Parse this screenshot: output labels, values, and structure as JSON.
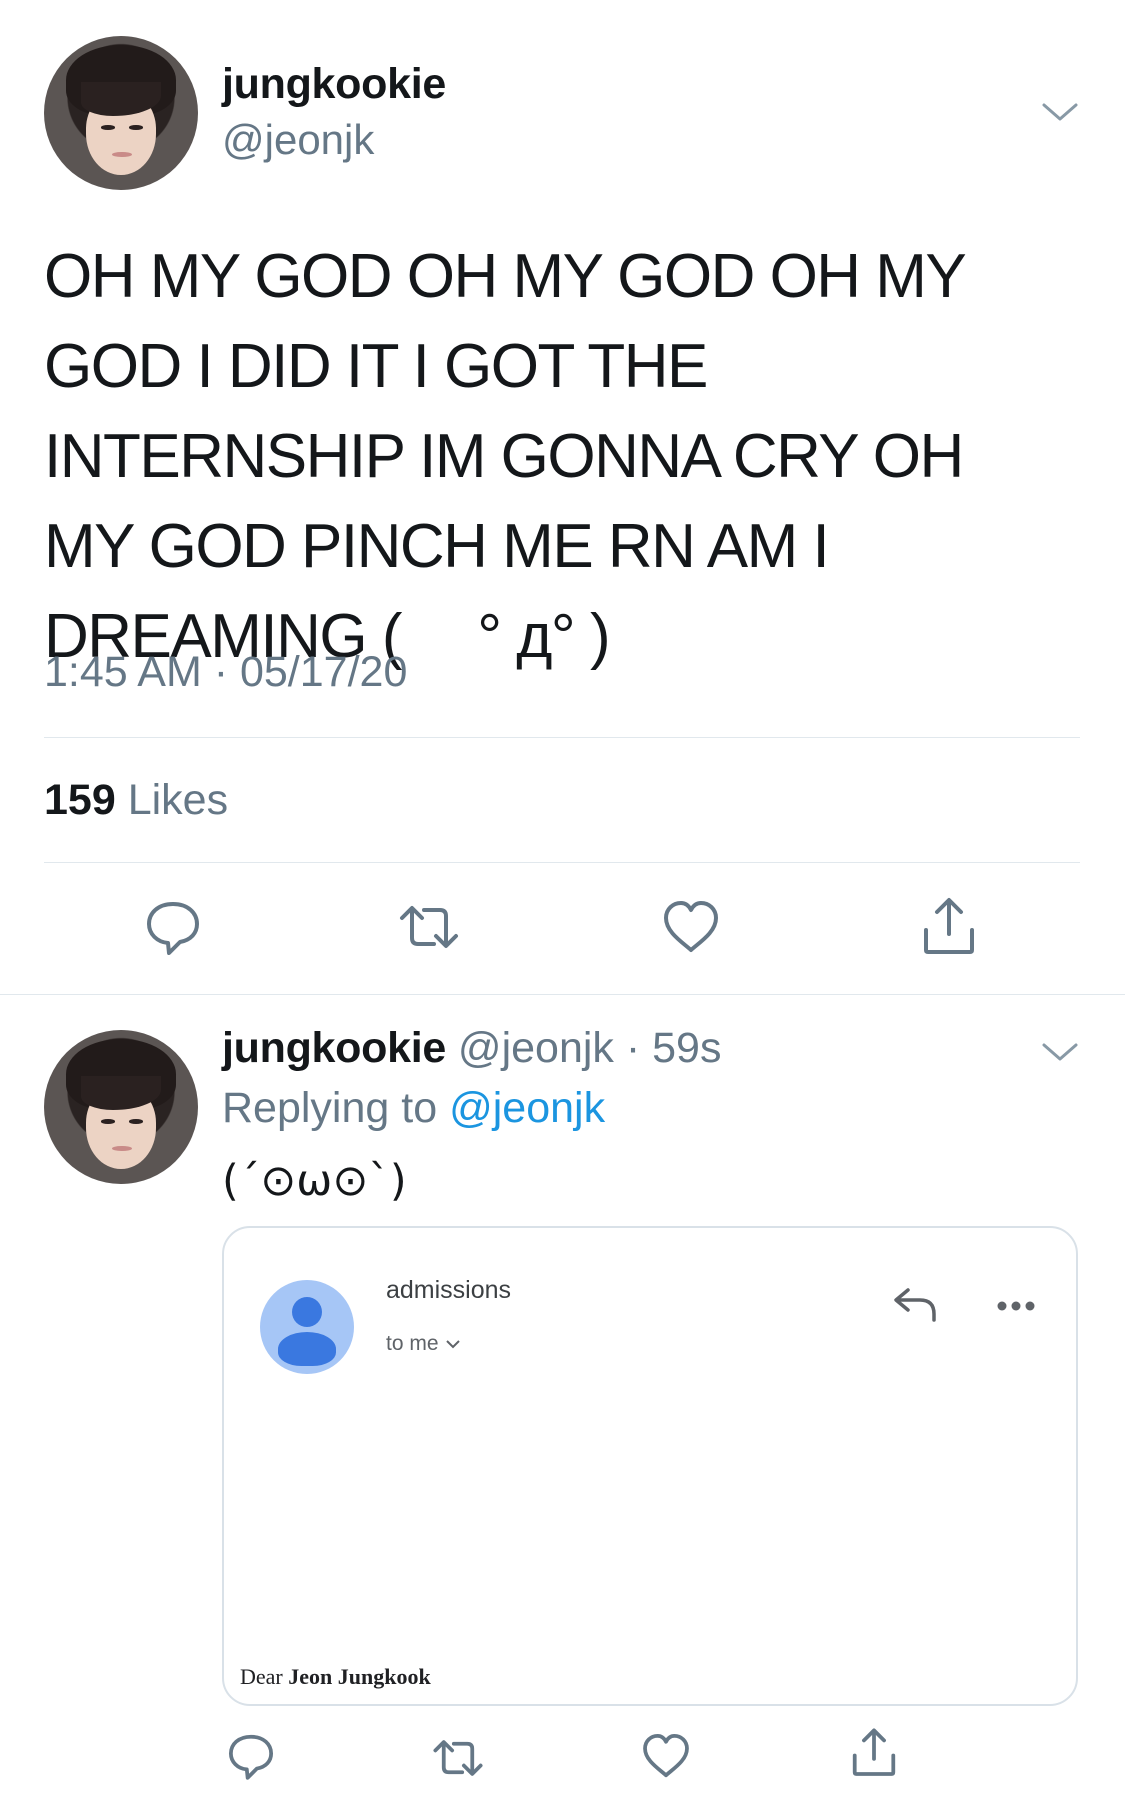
{
  "main_tweet": {
    "display_name": "jungkookie",
    "handle": "@jeonjk",
    "text": "OH MY GOD OH MY GOD OH MY GOD I DID IT I GOT THE INTERNSHIP IM GONNA CRY OH MY GOD PINCH ME RN AM I DREAMING ( 　° д° )",
    "timestamp": "1:45 AM · 05/17/20",
    "likes_count": "159",
    "likes_label": "Likes"
  },
  "reply_tweet": {
    "display_name": "jungkookie",
    "meta": "@jeonjk · 59s",
    "replying_label": "Replying to",
    "replying_to": "@jeonjk",
    "text": "(´⊙ω⊙`)"
  },
  "email_card": {
    "sender": "admissions",
    "to_label": "to me",
    "greeting_word": "Dear",
    "greeting_name": "Jeon Jungkook"
  },
  "colors": {
    "text": "#14171a",
    "secondary": "#657786",
    "link": "#1b95e0",
    "divider": "#e1e8ed"
  },
  "icons": {
    "main_actions": [
      "reply-icon",
      "retweet-icon",
      "like-icon",
      "share-icon"
    ],
    "email": [
      "person-icon",
      "email-reply-icon",
      "more-icon"
    ]
  }
}
